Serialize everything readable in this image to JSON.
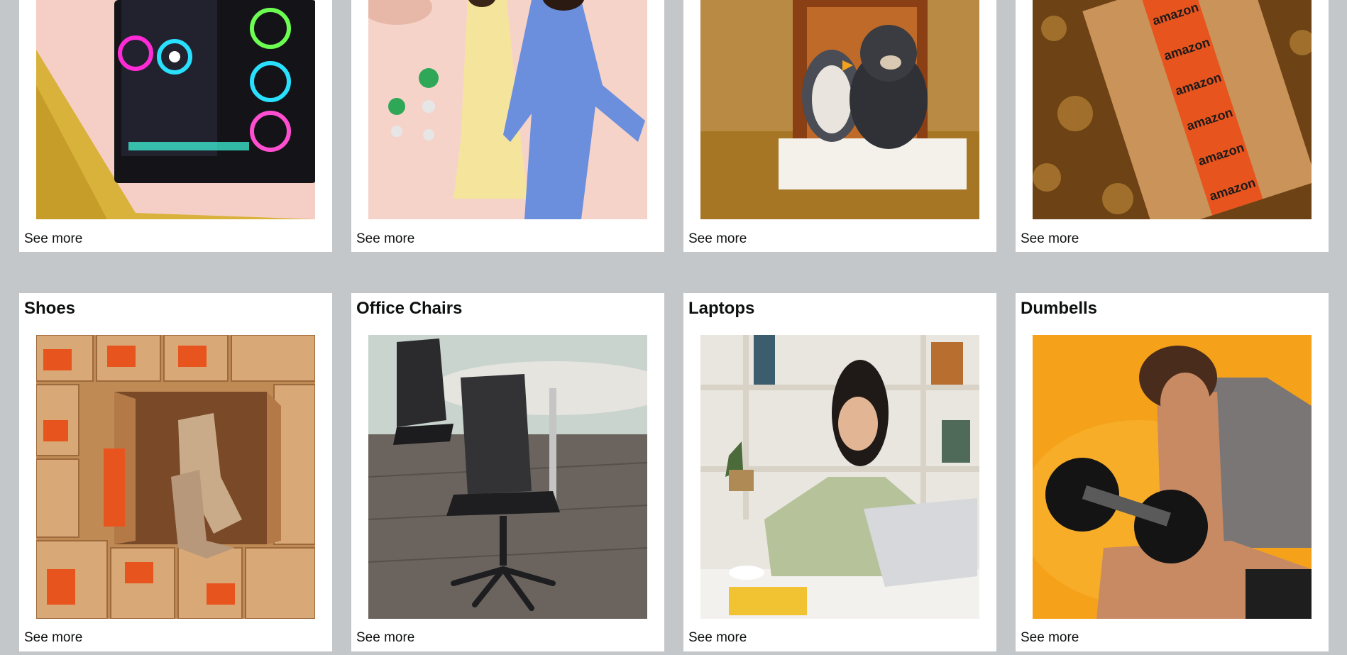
{
  "top_row": [
    {
      "see_more": "See more",
      "image": "gaming-pc-image"
    },
    {
      "see_more": "See more",
      "image": "fashion-image"
    },
    {
      "see_more": "See more",
      "image": "plush-toys-image"
    },
    {
      "see_more": "See more",
      "image": "amazon-box-image"
    }
  ],
  "bottom_row": [
    {
      "title": "Shoes",
      "see_more": "See more",
      "image": "shoes-boxes-image"
    },
    {
      "title": "Office Chairs",
      "see_more": "See more",
      "image": "office-chair-image"
    },
    {
      "title": "Laptops",
      "see_more": "See more",
      "image": "laptop-woman-image"
    },
    {
      "title": "Dumbells",
      "see_more": "See more",
      "image": "dumbbell-man-image"
    }
  ],
  "box_labels": [
    "amazon",
    "amazon",
    "amazon",
    "amazon",
    "amazon",
    "amazon"
  ],
  "colors": {
    "background": "#c4c7ca",
    "card": "#ffffff",
    "text": "#0f1111",
    "amazon_orange": "#e8541e"
  }
}
